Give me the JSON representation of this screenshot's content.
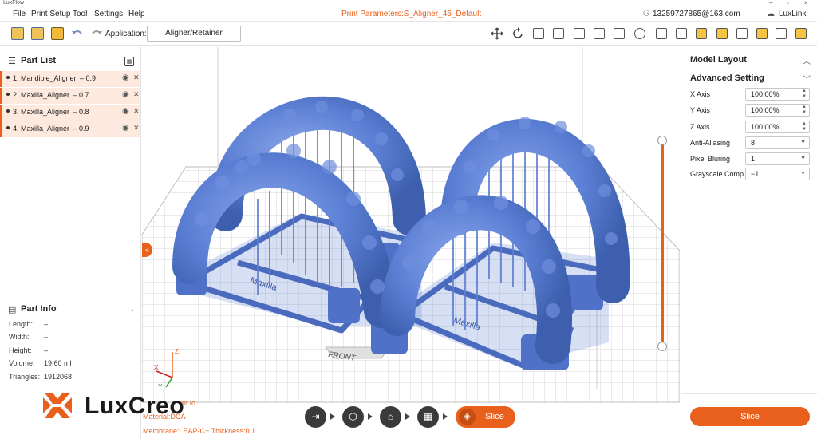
{
  "app": {
    "name": "LuxFlow"
  },
  "menu": [
    "File",
    "Print Setup",
    "Tool",
    "Settings",
    "Help"
  ],
  "print_params": "Print Parameters:S_Aligner_45_Default",
  "user_email": "13259727865@163.com",
  "luxlink": "LuxLink",
  "toolbar": {
    "application_label": "Application:",
    "application_value": "Aligner/Retainer"
  },
  "part_list": {
    "title": "Part List",
    "items": [
      "1. Mandible_Aligner – 0.9",
      "2. Maxilla_Aligner – 0.7",
      "3. Maxilla_Aligner – 0.8",
      "4. Maxilla_Aligner – 0.9"
    ]
  },
  "part_info": {
    "title": "Part Info",
    "rows": [
      {
        "k": "Length:",
        "v": "–"
      },
      {
        "k": "Width:",
        "v": "–"
      },
      {
        "k": "Height:",
        "v": "–"
      },
      {
        "k": "Volume:",
        "v": "19.60 ml"
      },
      {
        "k": "Triangles:",
        "v": "1912068"
      }
    ]
  },
  "viewport": {
    "front_label": "FRONT",
    "model_emboss": "Maxilla",
    "axes": {
      "x": "X",
      "y": "Y",
      "z": "Z"
    }
  },
  "overlay": {
    "brand": "LuxCreo",
    "file_name": "nt.io",
    "material": "Material:DCA",
    "membrane": "Membrane:LEAP-C+ Thickness:0.1"
  },
  "workflow": {
    "slice_label": "Slice"
  },
  "right_panel": {
    "model_layout": "Model Layout",
    "advanced_setting": "Advanced Setting",
    "fields": [
      {
        "label": "X Axis",
        "value": "100.00%",
        "kind": "spin"
      },
      {
        "label": "Y Axis",
        "value": "100.00%",
        "kind": "spin"
      },
      {
        "label": "Z Axis",
        "value": "100.00%",
        "kind": "spin"
      },
      {
        "label": "Anti-Aliasing",
        "value": "8",
        "kind": "select"
      },
      {
        "label": "Pixel Bluring",
        "value": "1",
        "kind": "select"
      },
      {
        "label": "Grayscale Comp",
        "value": "−1",
        "kind": "select"
      }
    ],
    "slice_button": "Slice"
  },
  "colors": {
    "accent": "#e8601c",
    "model": "#5b7fd4",
    "part_row_bg": "#fde9dd"
  }
}
